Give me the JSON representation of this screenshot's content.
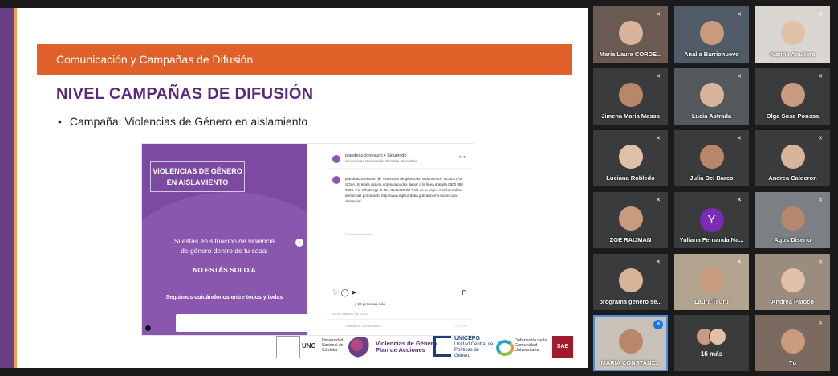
{
  "slide": {
    "section_band": "Comunicación y Campañas de Difusión",
    "title": "NIVEL CAMPAÑAS DE DIFUSIÓN",
    "bullet": "Campaña: Violencias de Género en aislamiento",
    "post_image": {
      "title_box": "VIOLENCIAS DE GÉNERO EN AISLAMIENTO",
      "mid_text_1": "Si estás en situación de violencia",
      "mid_text_2": "de género dentro de tu casa:",
      "no_estas_sola": "NO ESTÁS SOLO/A",
      "seguimos": "Seguimos cuidándonos entre todos y todas"
    },
    "post_side": {
      "account": "plandeaccionesunc • Siguiendo",
      "subtitle": "Universidad Nacional de Córdoba (Córdoba)",
      "caption": "plandeaccionesunc 📌 Violencias de género en aislamiento - NO ESTÁS SOLA. Si tenés alguna urgencia podés llamar a la línea gratuita 0800 888 9898. Por WhatsApp al 351-8141400 del Polo de la Mujer. Podés realizar denuncias por la web: http://www.mpfcordoba.gob.ar/como-hacer-una-denuncia/",
      "time": "18 horas • Ver sem",
      "likes": "y 20 personas más",
      "date": "19 DE MARZO DE 2020",
      "comment_placeholder": "Añade un comentario...",
      "publish": "Publicar"
    },
    "footer": {
      "unc": "UNC",
      "unc_sub": "Universidad Nacional de Córdoba",
      "vg_line1": "Violencias de Género.",
      "vg_line2": "Plan de Acciones",
      "ucepg_title": "UNICEPG",
      "ucepg_sub": "Unidad Central de Políticas de Género",
      "def_text": "Defensoría de la Comunidad Universitaria",
      "sae": "SAE"
    }
  },
  "participants": [
    {
      "name": "Maria Laura CORDE...",
      "bg": "#6a5a52"
    },
    {
      "name": "Analia Barrionuevo",
      "bg": "#4f5b66"
    },
    {
      "name": "Ivanna Aguilera",
      "bg": "#d9d6d2"
    },
    {
      "name": "Jimena Maria Massa",
      "bg": "#3a3b3d"
    },
    {
      "name": "Lucia Astrada",
      "bg": "#55595e"
    },
    {
      "name": "Olga Sosa Ponssa",
      "bg": "#3a3b3d"
    },
    {
      "name": "Luciana Robledo",
      "bg": "#3a3b3d"
    },
    {
      "name": "Julia Del Barco",
      "bg": "#3a3b3d"
    },
    {
      "name": "Andrea Calderon",
      "bg": "#3a3b3d"
    },
    {
      "name": "ZOE RAIJMAN",
      "bg": "#3a3b3d"
    },
    {
      "name": "Yuliana Fernanda Na...",
      "bg": "#3a3b3d",
      "initial": "Y"
    },
    {
      "name": "Agus Diserio",
      "bg": "#7c8084"
    },
    {
      "name": "programa genero se...",
      "bg": "#3a3b3d"
    },
    {
      "name": "Laura Tsuru",
      "bg": "#b3a48f"
    },
    {
      "name": "Andrea Patoco",
      "bg": "#9b8c80"
    },
    {
      "name": "MARIA CONSTANZ...",
      "bg": "#c8c1b8"
    },
    {
      "more": "16 más"
    },
    {
      "name": "Tú",
      "bg": "#7a6a60"
    }
  ]
}
